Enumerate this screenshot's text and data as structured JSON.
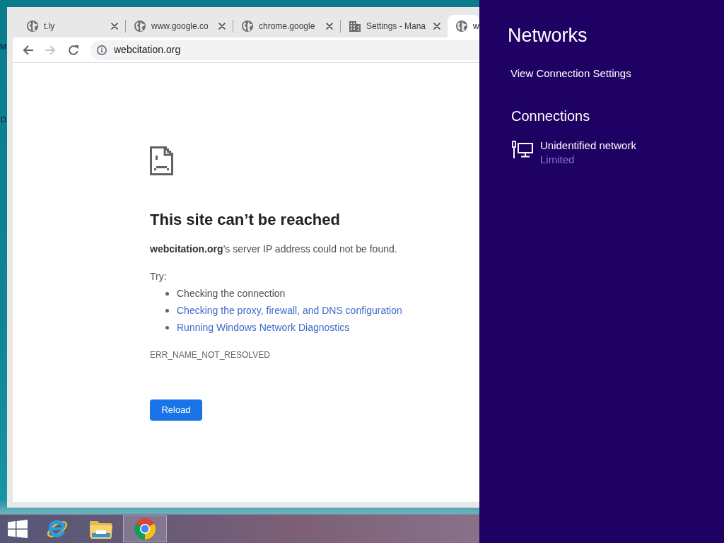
{
  "desktop": {
    "icon_labels": [
      "M",
      "D"
    ]
  },
  "browser": {
    "tabs": [
      {
        "title": "t.ly",
        "kind": "globe",
        "selected": false
      },
      {
        "title": "www.google.co",
        "kind": "globe",
        "selected": false
      },
      {
        "title": "chrome.google",
        "kind": "globe",
        "selected": false
      },
      {
        "title": "Settings - Mana",
        "kind": "building",
        "selected": false
      },
      {
        "title": "w",
        "kind": "globe",
        "selected": true
      }
    ],
    "nav_buttons": [
      {
        "kind": "back",
        "disabled": false
      },
      {
        "kind": "forward",
        "disabled": true
      },
      {
        "kind": "reload",
        "disabled": false
      }
    ],
    "address_bar": {
      "value": "webcitation.org"
    },
    "error_page": {
      "heading": "This site can’t be reached",
      "message": "**webcitation.org**’s server IP address could not be found.",
      "try_label": "Try:",
      "suggestions": [
        {
          "kind": "text",
          "text": "Checking the connection"
        },
        {
          "kind": "link",
          "text": "Checking the proxy, firewall, and DNS configuration"
        },
        {
          "kind": "link",
          "text": "Running Windows Network Diagnostics"
        }
      ],
      "error_code": "ERR_NAME_NOT_RESOLVED",
      "reload_button": "Reload"
    }
  },
  "networks_panel": {
    "title": "Networks",
    "settings_link": "View Connection Settings",
    "section_title": "Connections",
    "connections": [
      {
        "name": "Unidentified network",
        "status": "Limited"
      }
    ]
  },
  "taskbar": {
    "items": [
      {
        "kind": "start",
        "selected": false
      },
      {
        "kind": "web_e",
        "selected": false
      },
      {
        "kind": "folder",
        "selected": false
      },
      {
        "kind": "web_circle",
        "selected": true
      }
    ]
  }
}
